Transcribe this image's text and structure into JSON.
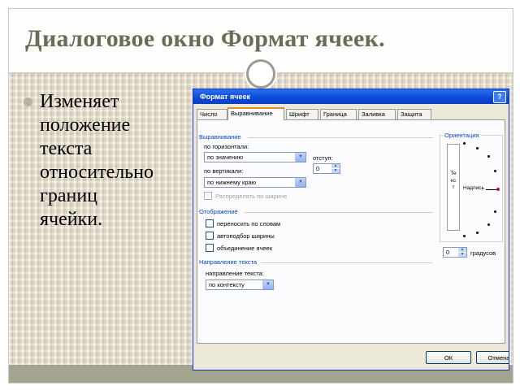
{
  "slide": {
    "title": "Диалоговое окно Формат ячеек.",
    "bullets": [
      "Изменяет\nположение\nтекста\nотносительно\nграниц\nячейки."
    ]
  },
  "dialog": {
    "title": "Формат ячеек",
    "help": "?",
    "tabs": [
      "Число",
      "Выравнивание",
      "Шрифт",
      "Граница",
      "Заливка",
      "Защита"
    ],
    "active_tab": "Выравнивание",
    "alignment_group": "Выравнивание",
    "horizontal_label": "по горизонтали:",
    "horizontal_value": "по значению",
    "indent_label": "отступ:",
    "indent_value": "0",
    "vertical_label": "по вертикали:",
    "vertical_value": "по нижнему краю",
    "distribute_label": "Распределять по ширине",
    "display_group": "Отображение",
    "checkboxes": [
      "переносить по словам",
      "автоподбор ширины",
      "объединение ячеек"
    ],
    "direction_group": "Направление текста",
    "direction_label": "направление текста:",
    "direction_value": "по контексту",
    "orientation_group": "Ориентация",
    "vertical_text": "Текст",
    "dial_text": "Надпись",
    "degrees_value": "0",
    "degrees_label": "градусов",
    "ok": "ОК",
    "cancel": "Отмена"
  },
  "colors": {
    "title_text": "#6b6b57",
    "dialog_titlebar": "#0a48d6",
    "bottom_bar": "#a4a48f",
    "group_label": "#0046d5"
  },
  "icons": [
    "help-icon",
    "dropdown-arrow-icon",
    "spinner-arrows-icon",
    "orientation-dial-icon",
    "bullet-icon"
  ]
}
